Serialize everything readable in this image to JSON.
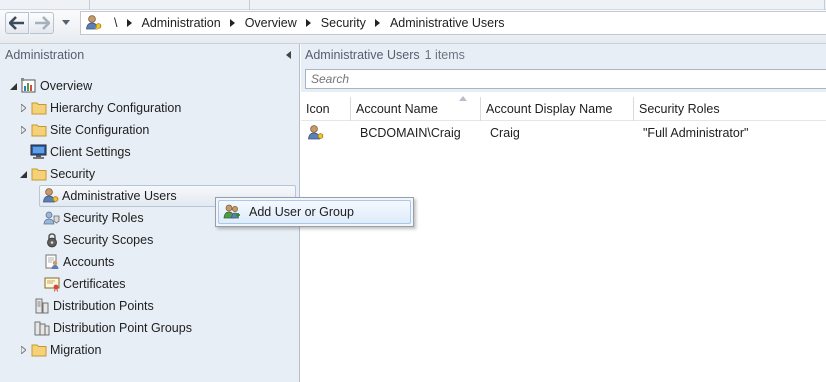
{
  "breadcrumb": {
    "root": "\\",
    "items": [
      "Administration",
      "Overview",
      "Security",
      "Administrative Users"
    ]
  },
  "navigation": {
    "header": "Administration",
    "tree": [
      {
        "label": "Overview",
        "icon": "overview-icon",
        "expanded": true
      },
      {
        "label": "Hierarchy Configuration",
        "icon": "folder-icon",
        "expanded": false
      },
      {
        "label": "Site Configuration",
        "icon": "folder-icon",
        "expanded": false
      },
      {
        "label": "Client Settings",
        "icon": "client-settings-icon"
      },
      {
        "label": "Security",
        "icon": "folder-icon",
        "expanded": true
      },
      {
        "label": "Administrative Users",
        "icon": "admin-user-icon",
        "selected": true
      },
      {
        "label": "Security Roles",
        "icon": "security-roles-icon"
      },
      {
        "label": "Security Scopes",
        "icon": "security-scopes-icon"
      },
      {
        "label": "Accounts",
        "icon": "accounts-icon"
      },
      {
        "label": "Certificates",
        "icon": "certificate-icon"
      },
      {
        "label": "Distribution Points",
        "icon": "distribution-points-icon"
      },
      {
        "label": "Distribution Point Groups",
        "icon": "distribution-point-groups-icon"
      },
      {
        "label": "Migration",
        "icon": "folder-icon",
        "expanded": false
      }
    ]
  },
  "results": {
    "title": "Administrative Users",
    "count": "1 items",
    "search_placeholder": "Search",
    "columns": [
      "Icon",
      "Account Name",
      "Account Display Name",
      "Security Roles"
    ],
    "rows": [
      {
        "icon": "admin-user-icon",
        "account_name": "BCDOMAIN\\Craig",
        "display_name": "Craig",
        "security_roles": "\"Full Administrator\""
      }
    ]
  },
  "context_menu": {
    "items": [
      {
        "label": "Add User or Group",
        "icon": "add-user-group-icon"
      }
    ]
  },
  "colors": {
    "nav_background": "#e8eef6",
    "selection_border": "#b9c6d6",
    "menu_highlight": "#dfecfa",
    "folder": "#f5d27a"
  }
}
